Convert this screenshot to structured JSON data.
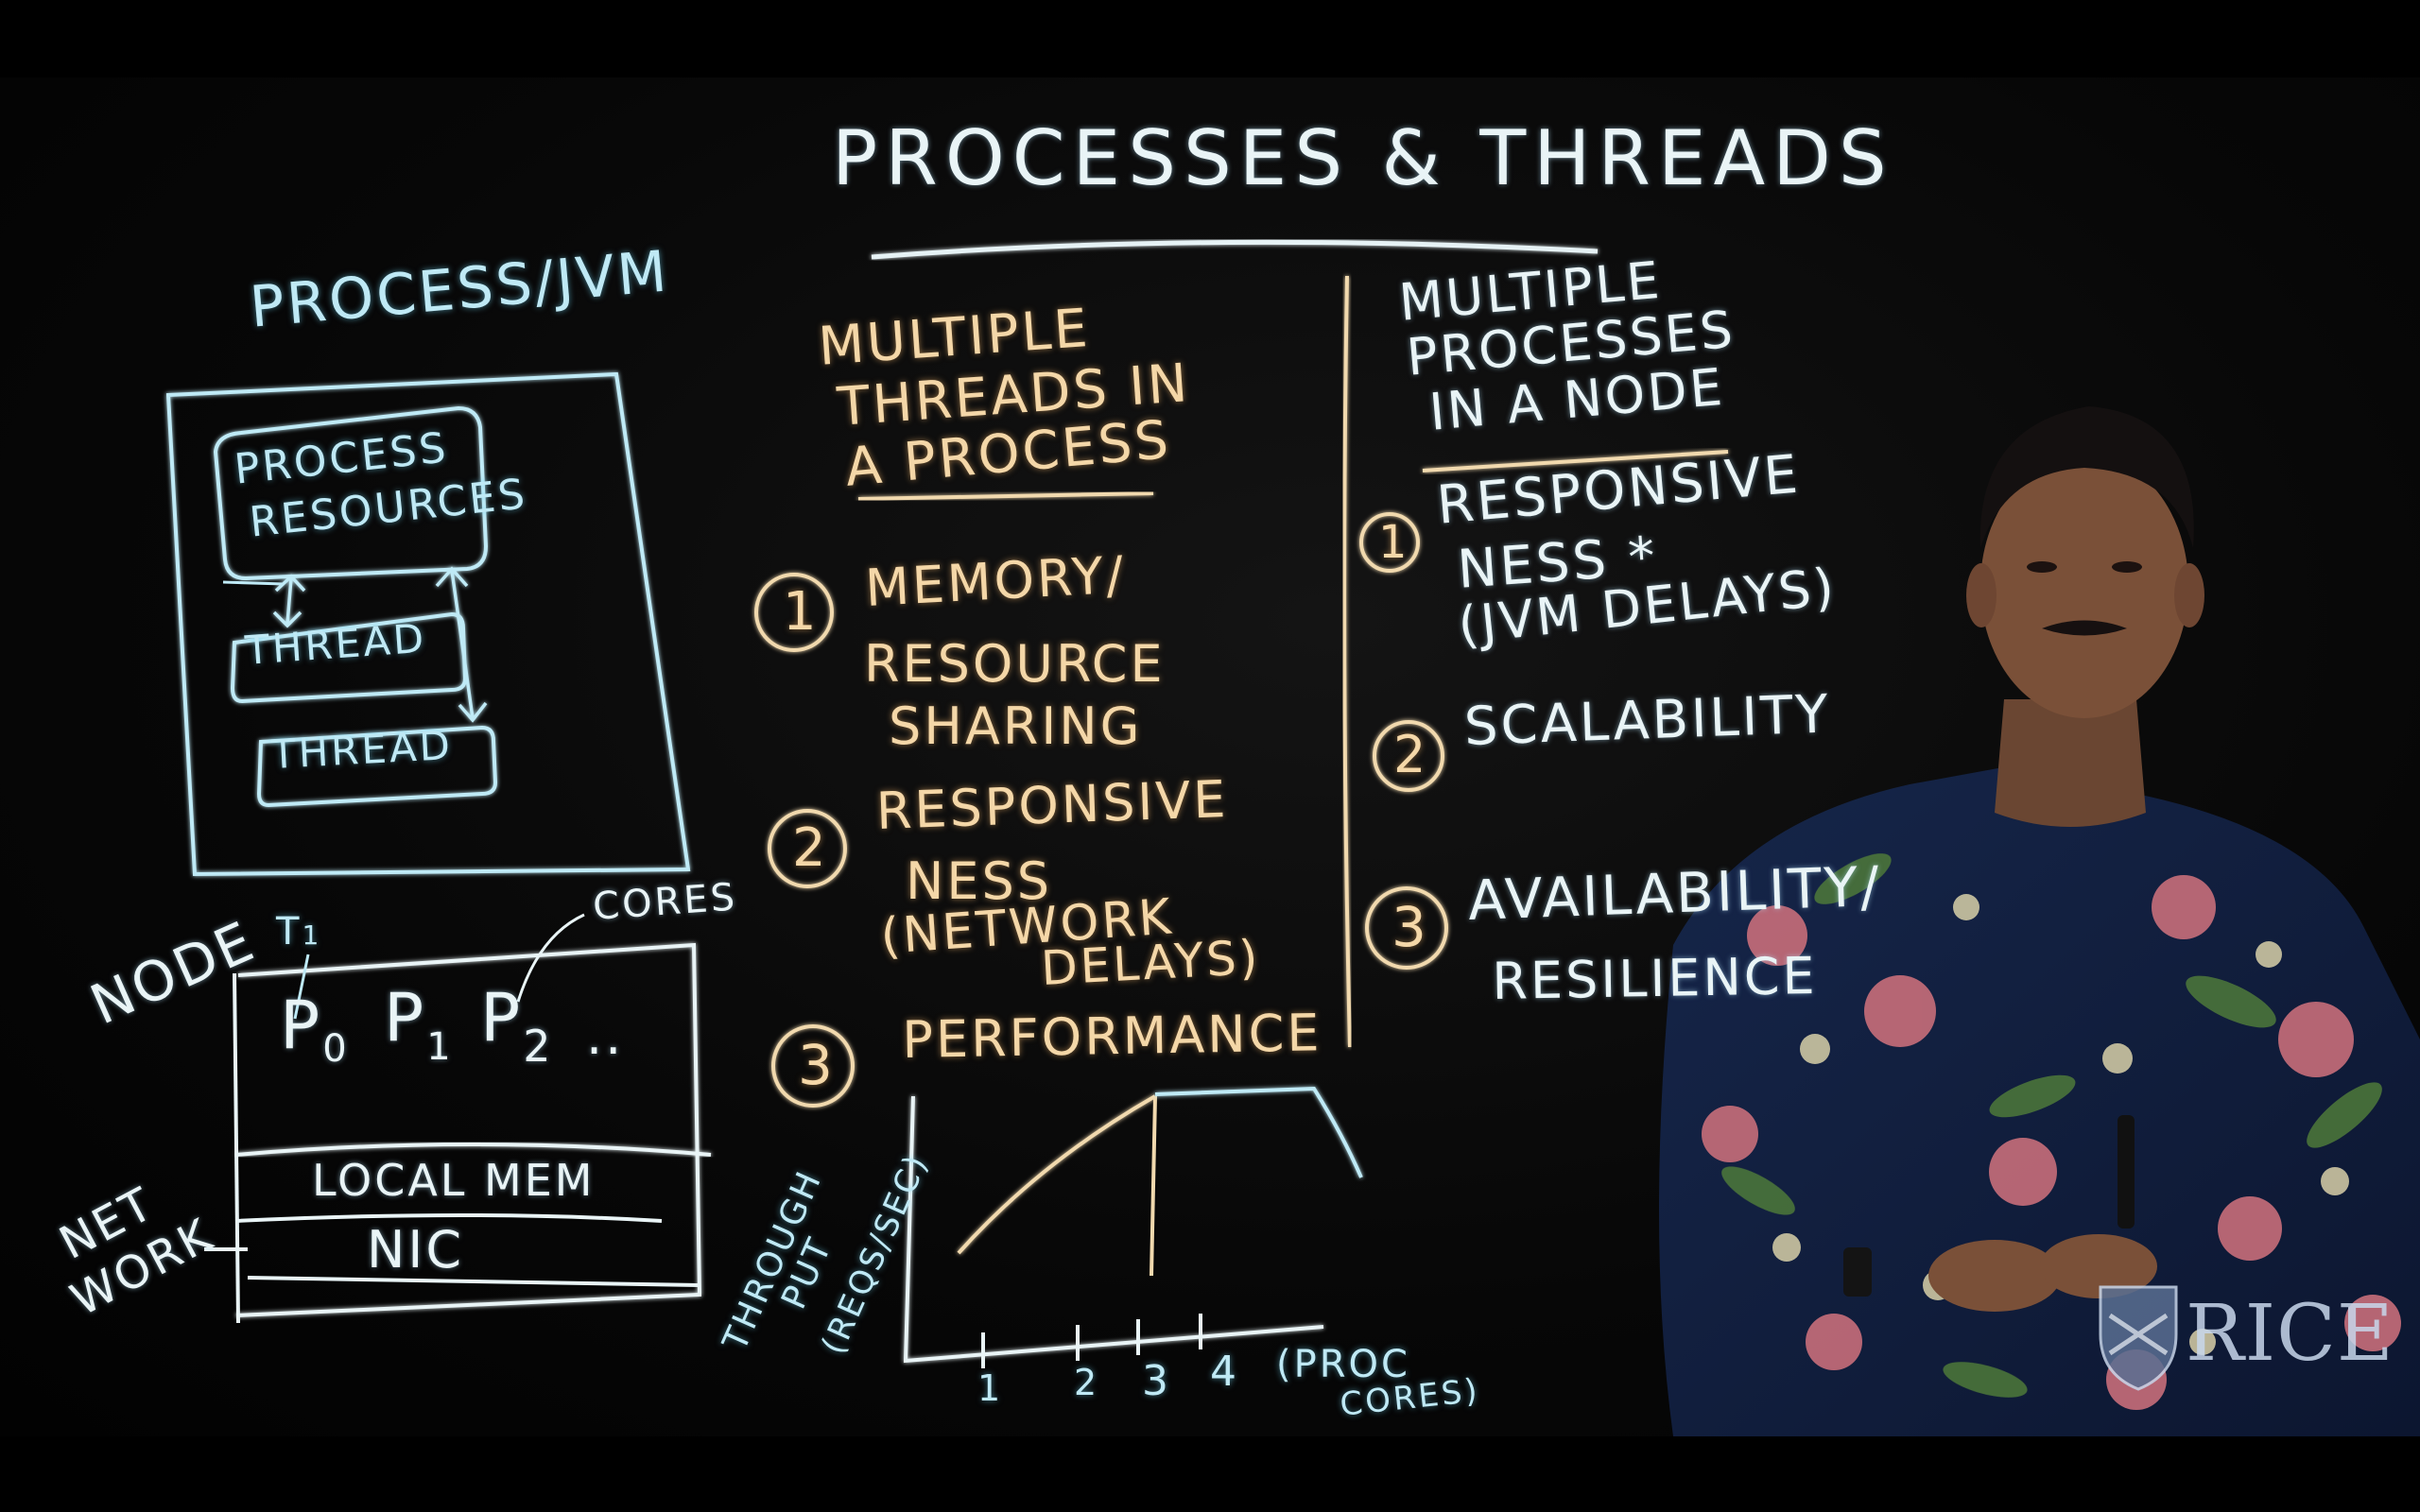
{
  "title": "PROCESSES & THREADS",
  "left_panel": {
    "heading": "PROCESS/JVM",
    "process_resources": [
      "PROCESS",
      "RESOURCES"
    ],
    "thread_1": "THREAD",
    "thread_2": "THREAD",
    "node_label": "NODE",
    "t1_label": "T",
    "t1_sub": "1",
    "cores_label": "CORES",
    "processors": [
      {
        "p": "P",
        "sub": "0"
      },
      {
        "p": "P",
        "sub": "1"
      },
      {
        "p": "P",
        "sub": "2"
      }
    ],
    "ellipsis": "..",
    "local_mem": "LOCAL MEM",
    "nic": "NIC",
    "network": [
      "NET",
      "WORK"
    ]
  },
  "middle_column": {
    "heading": [
      "MULTIPLE",
      "THREADS IN",
      "A  PROCESS"
    ],
    "items": [
      {
        "num": "1",
        "lines": [
          "MEMORY/",
          "RESOURCE",
          "SHARING"
        ]
      },
      {
        "num": "2",
        "lines": [
          "RESPONSIVE",
          "NESS",
          "(NETWORK",
          "DELAYS)"
        ]
      },
      {
        "num": "3",
        "lines": [
          "PERFORMANCE"
        ]
      }
    ],
    "graph": {
      "y_label": [
        "THROUGH",
        "PUT",
        "(REQS/SEC)"
      ],
      "x_ticks": [
        "1",
        "2",
        "3",
        "4"
      ],
      "x_label": [
        "(PROC",
        "CORES)"
      ]
    }
  },
  "right_column": {
    "heading": [
      "MULTIPLE",
      "PROCESSES",
      "IN A NODE"
    ],
    "items": [
      {
        "num": "1",
        "lines": [
          "RESPONSIVE",
          "NESS *",
          "(JVM DELAYS)"
        ]
      },
      {
        "num": "2",
        "lines": [
          "SCALABILITY"
        ]
      },
      {
        "num": "3",
        "lines": [
          "AVAILABILITY/",
          "RESILIENCE"
        ]
      }
    ]
  },
  "logo": {
    "text": "RICE",
    "icon": "rice-shield-icon"
  },
  "colors": {
    "chalk_white": "#e9f4f6",
    "chalk_cyan": "#bfe9f5",
    "chalk_orange": "#f4d7a8",
    "board": "#070707"
  }
}
